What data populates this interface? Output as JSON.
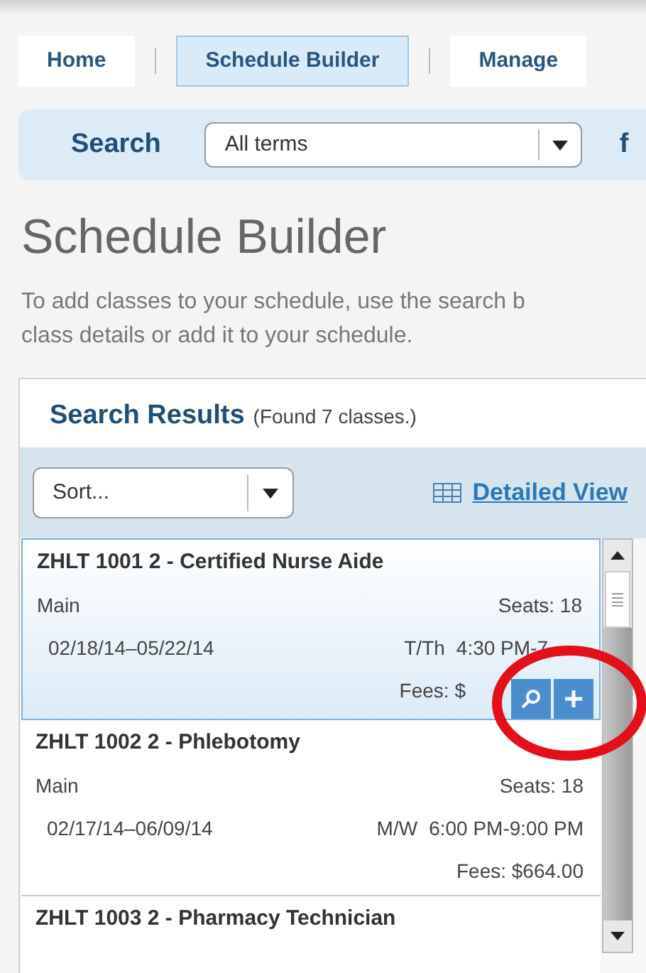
{
  "nav": {
    "tabs": [
      {
        "label": "Home",
        "selected": false
      },
      {
        "label": "Schedule Builder",
        "selected": true
      },
      {
        "label": "Manage",
        "selected": false
      }
    ]
  },
  "search_bar": {
    "label": "Search",
    "term": "All terms",
    "trailing": "f"
  },
  "heading": "Schedule Builder",
  "description_lines": [
    "To add classes to your schedule, use the search b",
    "class details or add it to your schedule."
  ],
  "results": {
    "title": "Search Results",
    "count": "(Found 7 classes.)",
    "sort": "Sort...",
    "view_link": "Detailed View",
    "classes": [
      {
        "title": "ZHLT 1001 2 - Certified Nurse Aide",
        "campus": "Main",
        "seats": "Seats: 18",
        "dates": "02/18/14–05/22/14",
        "days": "T/Th",
        "time": "4:30 PM-7",
        "fees": "Fees: $",
        "selected": true
      },
      {
        "title": "ZHLT 1002 2 - Phlebotomy",
        "campus": "Main",
        "seats": "Seats: 18",
        "dates": "02/17/14–06/09/14",
        "days": "M/W",
        "time": "6:00 PM-9:00 PM",
        "fees": "Fees: $664.00",
        "selected": false
      },
      {
        "title": "ZHLT 1003 2 - Pharmacy Technician",
        "selected": false
      }
    ]
  },
  "annotation_circle": true
}
